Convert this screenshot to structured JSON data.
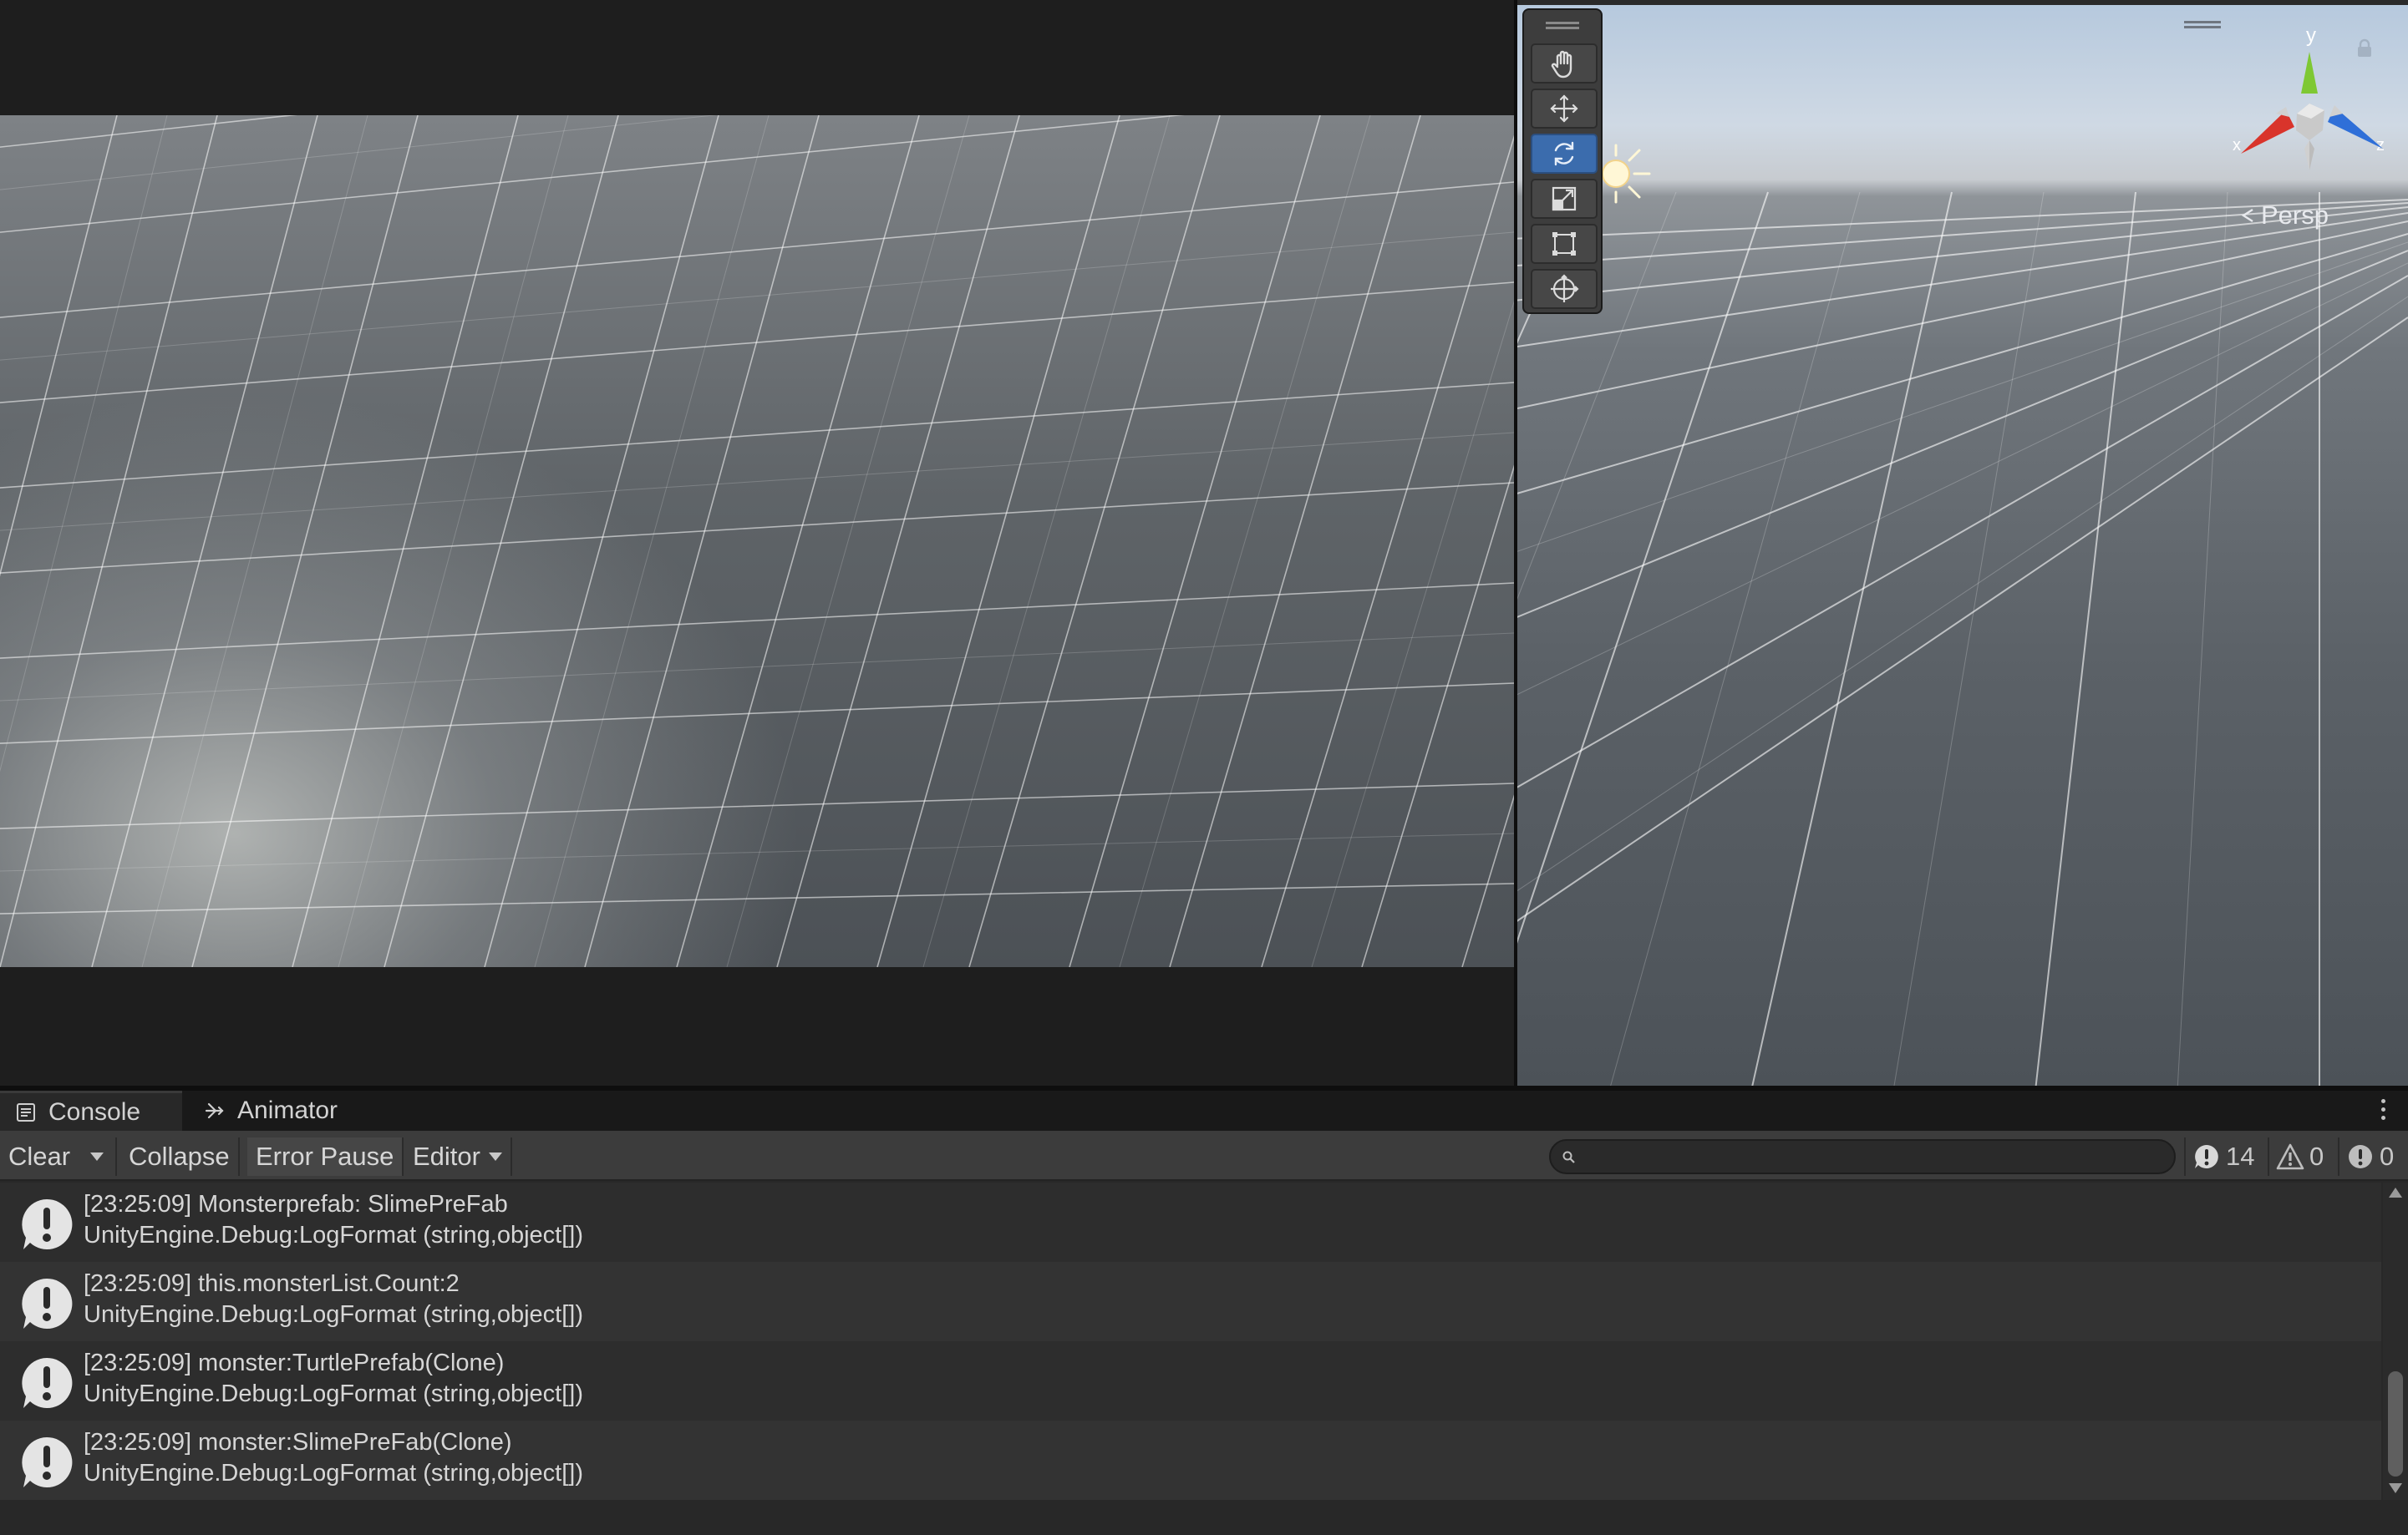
{
  "scene": {
    "persp_label": "Persp",
    "gizmo_axes": {
      "x": "x",
      "y": "y",
      "z": "z"
    },
    "tools": [
      {
        "name": "hand-tool",
        "active": false
      },
      {
        "name": "move-tool",
        "active": false
      },
      {
        "name": "rotate-tool",
        "active": true
      },
      {
        "name": "scale-tool",
        "active": false
      },
      {
        "name": "rect-tool",
        "active": false
      },
      {
        "name": "transform-tool",
        "active": false
      }
    ]
  },
  "console": {
    "tabs": [
      {
        "label": "Console",
        "icon": "console-icon",
        "active": true
      },
      {
        "label": "Animator",
        "icon": "animator-icon",
        "active": false
      }
    ],
    "toolbar": {
      "clear_label": "Clear",
      "collapse_label": "Collapse",
      "error_pause_label": "Error Pause",
      "editor_label": "Editor",
      "search_placeholder": "",
      "info_count": "14",
      "warning_count": "0",
      "error_count": "0"
    },
    "logs": [
      {
        "line1": "[23:25:09] Monsterprefab: SlimePreFab",
        "line2": "UnityEngine.Debug:LogFormat (string,object[])"
      },
      {
        "line1": "[23:25:09] this.monsterList.Count:2",
        "line2": "UnityEngine.Debug:LogFormat (string,object[])"
      },
      {
        "line1": "[23:25:09] monster:TurtlePrefab(Clone)",
        "line2": "UnityEngine.Debug:LogFormat (string,object[])"
      },
      {
        "line1": "[23:25:09] monster:SlimePreFab(Clone)",
        "line2": "UnityEngine.Debug:LogFormat (string,object[])"
      }
    ]
  },
  "colors": {
    "active_tool": "#3b6cad",
    "axis_x": "#d9342b",
    "axis_y": "#7ec833",
    "axis_z": "#2f6fd8",
    "panel_bg": "#282828",
    "toolbar_bg": "#3c3c3c"
  }
}
